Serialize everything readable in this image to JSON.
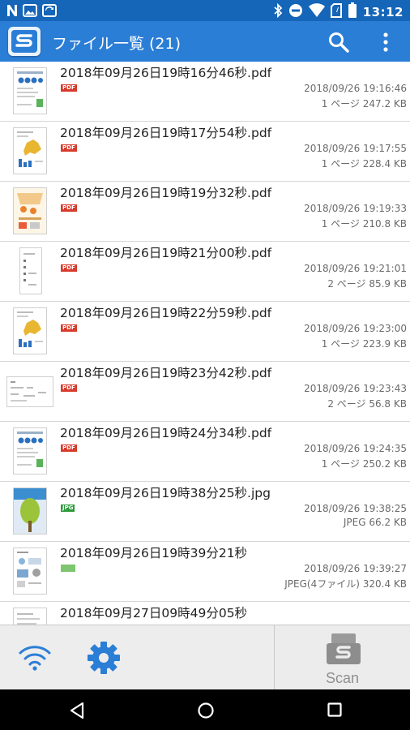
{
  "status_bar": {
    "time": "13:12",
    "icons": [
      "n-icon",
      "image-icon",
      "sync-icon",
      "bluetooth-icon",
      "do-not-disturb-icon",
      "wifi-icon",
      "no-sim-icon",
      "battery-icon"
    ]
  },
  "app_bar": {
    "title": "ファイル一覧",
    "count": "(21)",
    "logo": "scansnap-logo-icon",
    "actions": [
      "search-icon",
      "more-vert-icon"
    ]
  },
  "files": [
    {
      "name": "2018年09月26日19時16分46秒.pdf",
      "type": "PDF",
      "date": "2018/09/26 19:16:46",
      "meta": "1 ページ 247.2 KB",
      "thumb": "portrait"
    },
    {
      "name": "2018年09月26日19時17分54秒.pdf",
      "type": "PDF",
      "date": "2018/09/26 19:17:55",
      "meta": "1 ページ 228.4 KB",
      "thumb": "portrait"
    },
    {
      "name": "2018年09月26日19時19分32秒.pdf",
      "type": "PDF",
      "date": "2018/09/26 19:19:33",
      "meta": "1 ページ 210.8 KB",
      "thumb": "portrait"
    },
    {
      "name": "2018年09月26日19時21分00秒.pdf",
      "type": "PDF",
      "date": "2018/09/26 19:21:01",
      "meta": "2 ページ 85.9 KB",
      "thumb": "portrait"
    },
    {
      "name": "2018年09月26日19時22分59秒.pdf",
      "type": "PDF",
      "date": "2018/09/26 19:23:00",
      "meta": "1 ページ 223.9 KB",
      "thumb": "portrait"
    },
    {
      "name": "2018年09月26日19時23分42秒.pdf",
      "type": "PDF",
      "date": "2018/09/26 19:23:43",
      "meta": "2 ページ 56.8 KB",
      "thumb": "landscape"
    },
    {
      "name": "2018年09月26日19時24分34秒.pdf",
      "type": "PDF",
      "date": "2018/09/26 19:24:35",
      "meta": "1 ページ 250.2 KB",
      "thumb": "portrait"
    },
    {
      "name": "2018年09月26日19時38分25秒.jpg",
      "type": "JPG",
      "date": "2018/09/26 19:38:25",
      "meta": "JPEG 66.2 KB",
      "thumb": "portrait"
    },
    {
      "name": "2018年09月26日19時39分21秒",
      "type": "JPG",
      "date": "2018/09/26 19:39:27",
      "meta": "JPEG(4ファイル) 320.4 KB",
      "thumb": "portrait"
    },
    {
      "name": "2018年09月27日09時49分05秒",
      "type": "",
      "date": "",
      "meta": "",
      "thumb": "portrait"
    }
  ],
  "bottom_bar": {
    "wifi_icon": "wifi-connect-icon",
    "settings_icon": "gear-icon",
    "scan_label": "Scan"
  },
  "nav_bar": {
    "buttons": [
      "back-icon",
      "home-icon",
      "recent-apps-icon"
    ]
  },
  "colors": {
    "status_bar": "#1565b8",
    "app_bar": "#2b7ed6",
    "accent": "#2b7ed6",
    "pdf_badge": "#d83a2b",
    "jpg_badge": "#2e9a3c"
  }
}
